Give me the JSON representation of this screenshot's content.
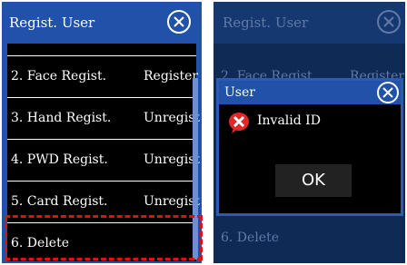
{
  "left": {
    "title": "Regist. User",
    "rows": [
      {
        "label": "2. Face Regist.",
        "value": "Register"
      },
      {
        "label": "3. Hand Regist.",
        "value": "Unregist"
      },
      {
        "label": "4. PWD Regist.",
        "value": "Unregist"
      },
      {
        "label": "5. Card Regist.",
        "value": "Unregist"
      },
      {
        "label": "6. Delete",
        "value": ""
      }
    ]
  },
  "right": {
    "title": "Regist. User",
    "bg_row_top_label": "2. Face Regist.",
    "bg_row_top_value": "Register",
    "bg_row_bottom_label": "6. Delete",
    "dialog": {
      "title": "User",
      "message": "Invalid ID",
      "ok_label": "OK"
    }
  },
  "colors": {
    "accent": "#1f52a8",
    "highlight": "#e01010",
    "error": "#e02828"
  }
}
